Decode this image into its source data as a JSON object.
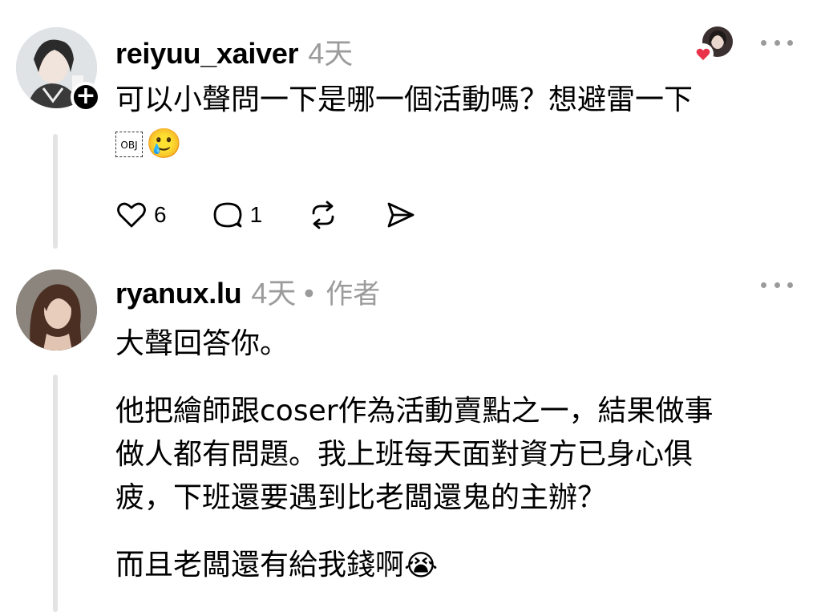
{
  "comments": [
    {
      "username": "reiyuu_xaiver",
      "time": "4天",
      "author_tag": "",
      "text_line1": "可以小聲問一下是哪一個活動嗎？想避雷一下",
      "obj_placeholder": "OBJ",
      "trailing_emoji": "🥲",
      "likes": "6",
      "replies": "1",
      "follow_badge": "+",
      "icons": [
        "heart-icon",
        "comment-icon",
        "repost-icon",
        "share-icon",
        "more-icon"
      ]
    },
    {
      "username": "ryanux.lu",
      "time": "4天",
      "author_tag": "• 作者",
      "paragraph1": "大聲回答你。",
      "paragraph2_line1": "他把繪師跟coser作為活動賣點之一，結果做事",
      "paragraph2_line2": "做人都有問題。我上班每天面對資方已身心俱",
      "paragraph2_line3": "疲，下班還要遇到比老闆還鬼的主辦？",
      "paragraph3": "而且老闆還有給我錢啊",
      "paragraph3_emoji": "😭",
      "icons": [
        "more-icon"
      ]
    }
  ],
  "colors": {
    "text": "#000000",
    "muted": "#9b9b9b",
    "thread_line": "#e3e3e3",
    "like_heart": "#e8334a"
  }
}
